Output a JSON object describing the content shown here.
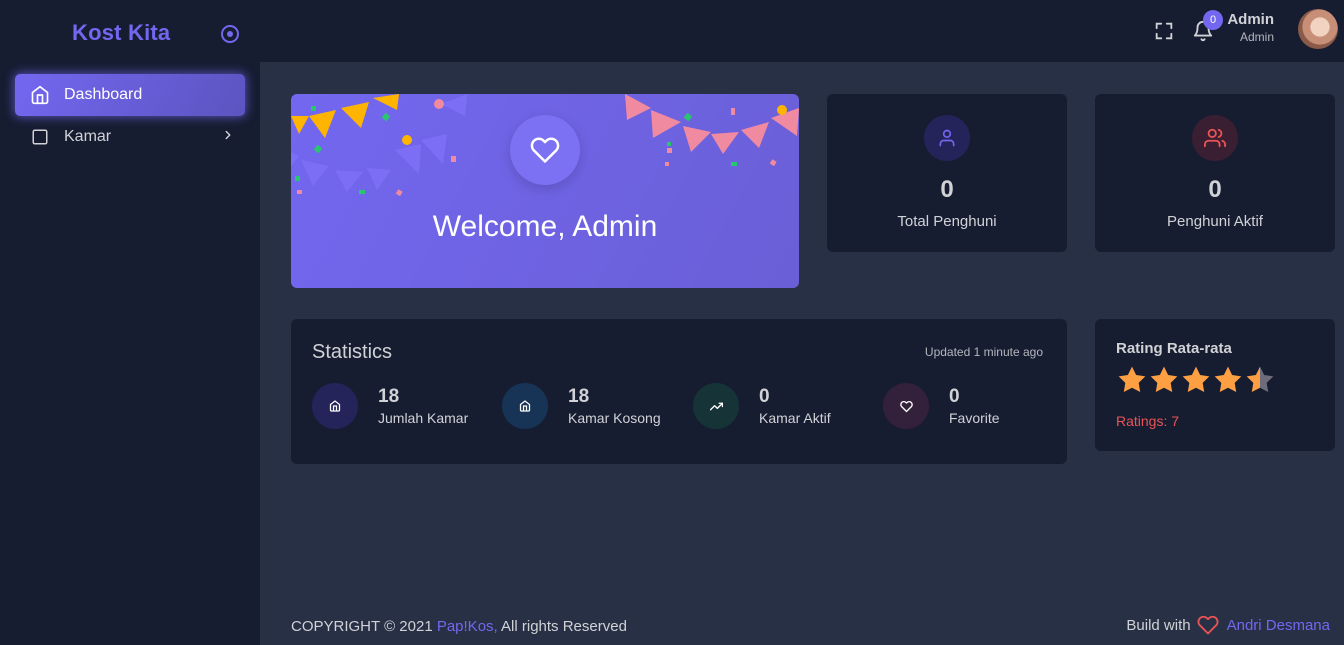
{
  "sidebar": {
    "brand": "Kost Kita",
    "items": [
      {
        "label": "Dashboard",
        "icon": "home-icon",
        "active": true
      },
      {
        "label": "Kamar",
        "icon": "square-icon",
        "active": false
      }
    ]
  },
  "header": {
    "notification_count": "0",
    "user_name": "Admin",
    "user_role": "Admin"
  },
  "welcome": {
    "title": "Welcome, Admin"
  },
  "stats_cards": [
    {
      "value": "0",
      "label": "Total Penghuni",
      "icon": "user-icon"
    },
    {
      "value": "0",
      "label": "Penghuni Aktif",
      "icon": "users-icon"
    }
  ],
  "statistics": {
    "title": "Statistics",
    "updated": "Updated 1 minute ago",
    "items": [
      {
        "value": "18",
        "label": "Jumlah Kamar",
        "icon": "home-icon"
      },
      {
        "value": "18",
        "label": "Kamar Kosong",
        "icon": "home-icon"
      },
      {
        "value": "0",
        "label": "Kamar Aktif",
        "icon": "trending-up-icon"
      },
      {
        "value": "0",
        "label": "Favorite",
        "icon": "heart-icon"
      }
    ]
  },
  "rating": {
    "title": "Rating Rata-rata",
    "stars_value": 4.5,
    "stars_max": 5,
    "count_text": "Ratings: 7"
  },
  "footer": {
    "copyright_prefix": "COPYRIGHT © 2021 ",
    "brand": "Pap!Kos,",
    "copyright_suffix": " All rights Reserved",
    "build_with": "Build with",
    "author": "Andri Desmana"
  },
  "colors": {
    "primary": "#7367f0",
    "danger": "#ea5455",
    "star": "#ff9f43",
    "card_bg": "#161d31",
    "body_bg": "#283046"
  }
}
